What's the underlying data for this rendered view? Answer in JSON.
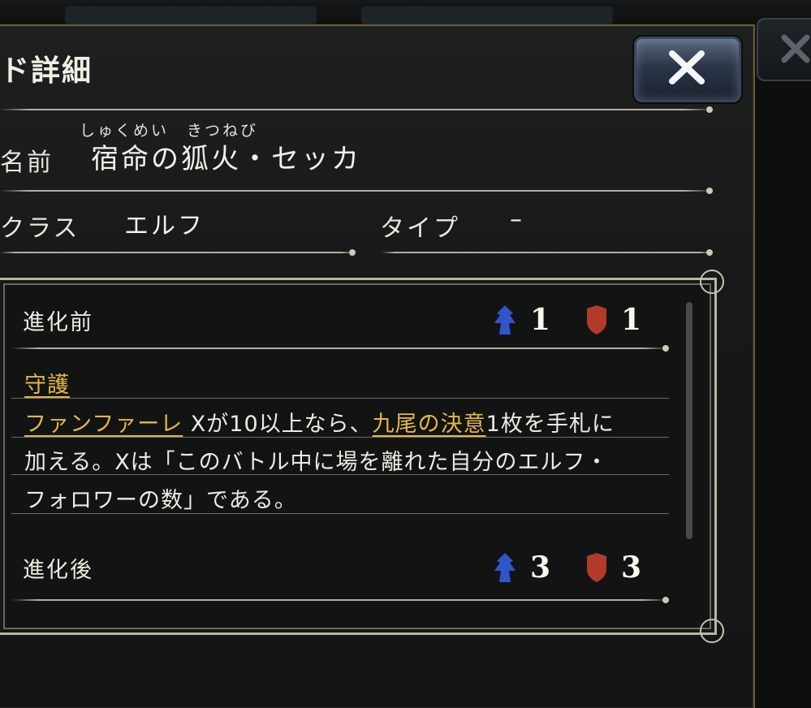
{
  "dialog": {
    "title": "ド詳細",
    "close_label": "×"
  },
  "card": {
    "name_label": "名前",
    "name_ruby": "しゅくめい　きつねび",
    "name_value": "宿命の狐火・セッカ",
    "class_label": "クラス",
    "class_value": "エルフ",
    "type_label": "タイプ",
    "type_value": "–"
  },
  "before_evolve": {
    "label": "進化前",
    "attack": "1",
    "defense": "1",
    "keyword": "守護",
    "line1_kw": "ファンファーレ",
    "line1_mid": " Xが10以上なら、",
    "line1_kw2": "九尾の決意",
    "line1_end": "1枚を手札に",
    "line2": "加える。Xは「このバトル中に場を離れた自分のエルフ・",
    "line3": "フォロワーの数」である。"
  },
  "after_evolve": {
    "label": "進化後",
    "attack": "3",
    "defense": "3"
  },
  "colors": {
    "attack_icon": "#2f55c8",
    "defense_icon": "#b23a2a",
    "keyword": "#e3b842",
    "frame": "#bcb5a2"
  },
  "icons": {
    "attack": "attack-icon",
    "defense": "defense-icon",
    "close": "close-icon"
  }
}
